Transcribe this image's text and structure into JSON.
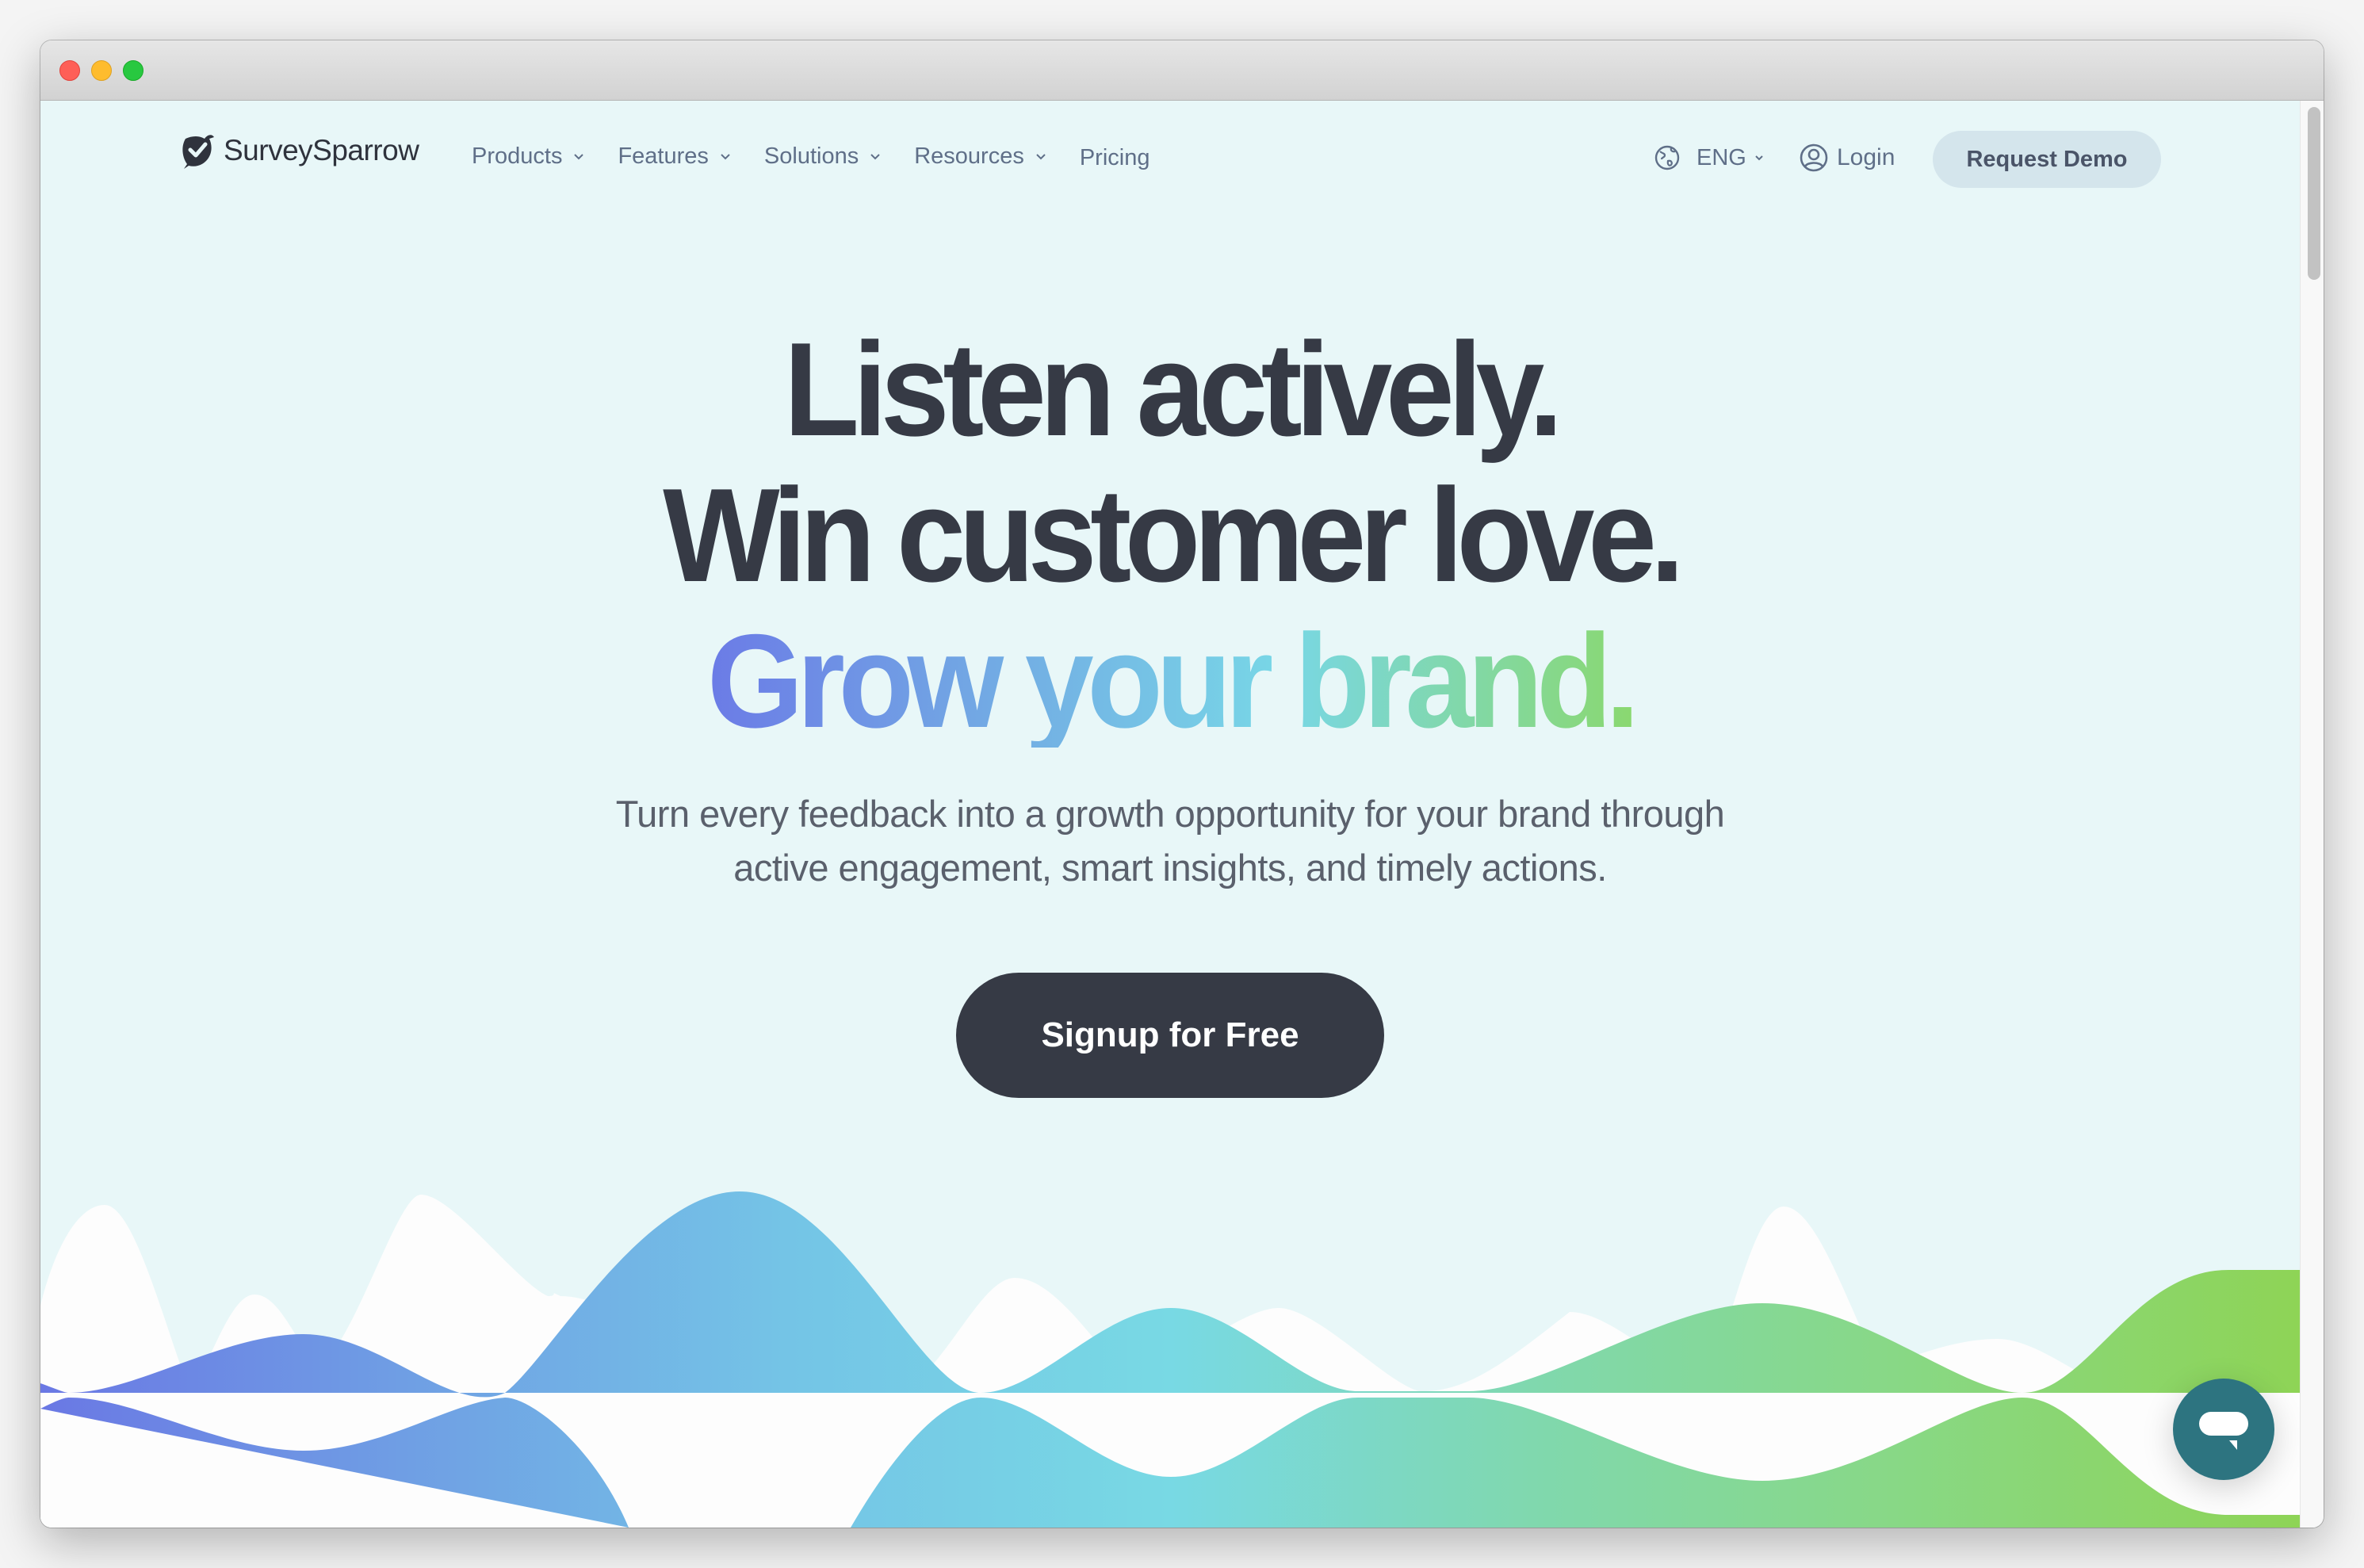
{
  "window": {
    "traffic_lights": [
      "close",
      "minimize",
      "zoom"
    ]
  },
  "header": {
    "logo_text": "SurveySparrow",
    "logo_icon": "sparrow-check-icon",
    "nav": [
      {
        "label": "Products",
        "has_dropdown": true
      },
      {
        "label": "Features",
        "has_dropdown": true
      },
      {
        "label": "Solutions",
        "has_dropdown": true
      },
      {
        "label": "Resources",
        "has_dropdown": true
      },
      {
        "label": "Pricing",
        "has_dropdown": false
      }
    ],
    "language": {
      "label": "ENG",
      "icon": "globe-icon"
    },
    "login": {
      "label": "Login",
      "icon": "user-circle-icon"
    },
    "request_demo": "Request Demo"
  },
  "hero": {
    "line1": "Listen actively.",
    "line2": "Win customer love.",
    "line3": "Grow your brand.",
    "subtitle_line1": "Turn every feedback into a growth opportunity for your brand through",
    "subtitle_line2": "active engagement, smart insights, and timely actions.",
    "cta": "Signup for Free"
  },
  "colors": {
    "background": "#e8f7f8",
    "text_dark": "#363a45",
    "nav_text": "#5f6f88",
    "demo_button_bg": "#d4e5ec",
    "cta_bg": "#363a45",
    "gradient": [
      "#6b7be6",
      "#72a9e4",
      "#78d7e6",
      "#8ad870"
    ],
    "chat_bubble": "#2d7480"
  },
  "chat_widget": {
    "icon": "chat-bubble-icon"
  }
}
